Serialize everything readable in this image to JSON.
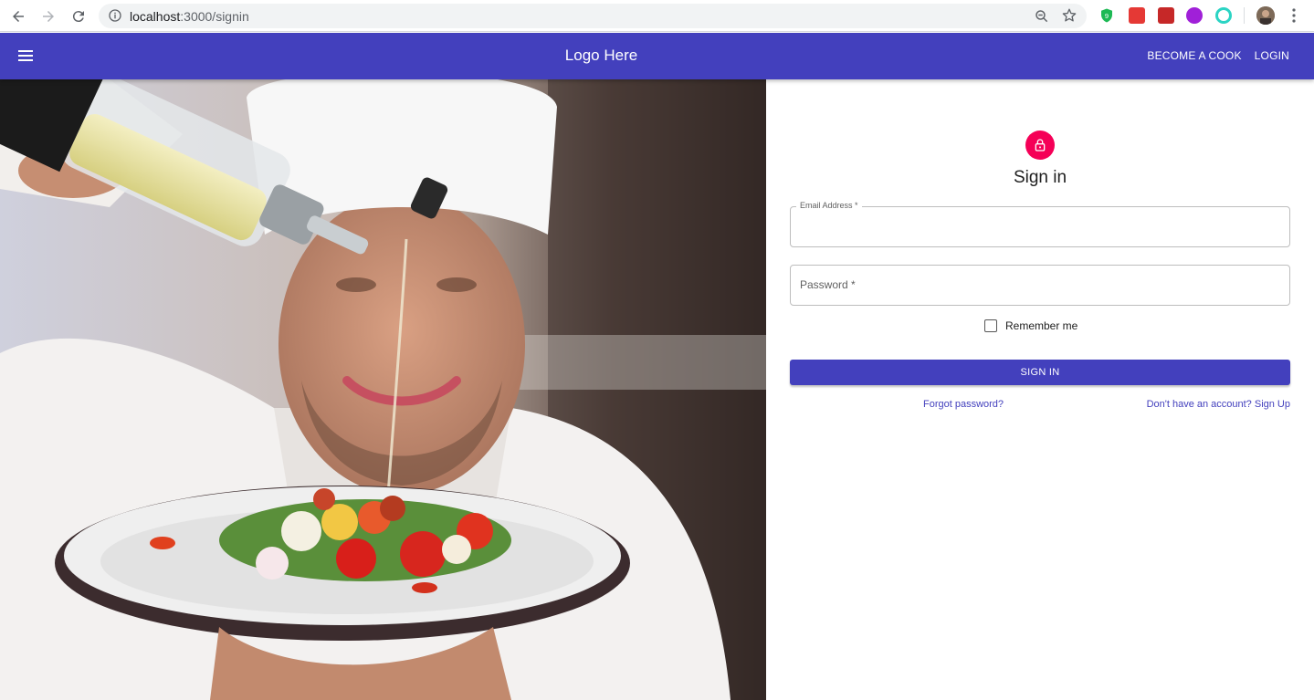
{
  "browser": {
    "url_host": "localhost",
    "url_path": ":3000/signin",
    "icons": [
      "back-icon",
      "forward-icon",
      "reload-icon",
      "info-icon",
      "zoom-icon",
      "star-icon",
      "menu-dots-icon"
    ]
  },
  "appbar": {
    "logo": "Logo Here",
    "links": [
      {
        "label": "BECOME A COOK"
      },
      {
        "label": "LOGIN"
      }
    ],
    "color": "#4340bd"
  },
  "signin": {
    "title": "Sign in",
    "email_label": "Email Address *",
    "email_value": "",
    "password_label": "Password *",
    "password_value": "",
    "remember_label": "Remember me",
    "remember_checked": false,
    "submit_label": "SIGN IN",
    "forgot_link": "Forgot password?",
    "signup_link": "Don't have an account? Sign Up",
    "lock_color": "#f50057"
  }
}
